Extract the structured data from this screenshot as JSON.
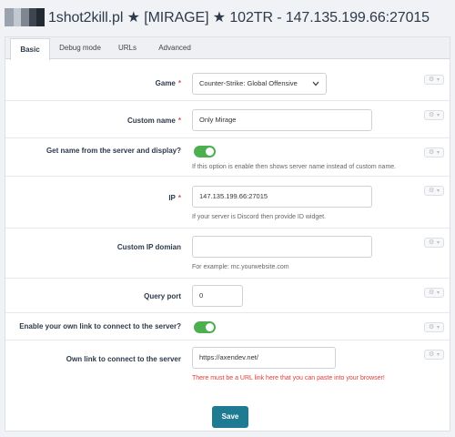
{
  "header": {
    "title": "1shot2kill.pl ★ [MIRAGE] ★ 102TR - 147.135.199.66:27015"
  },
  "tabs": [
    {
      "label": "Basic",
      "active": true
    },
    {
      "label": "Debug mode",
      "active": false
    },
    {
      "label": "URLs",
      "active": false
    },
    {
      "label": "Advanced",
      "active": false
    }
  ],
  "form": {
    "game": {
      "label": "Game",
      "required_mark": "*",
      "value": "Counter-Strike: Global Offensive"
    },
    "custom_name": {
      "label": "Custom name",
      "required_mark": "*",
      "value": "Only Mirage"
    },
    "get_name": {
      "label": "Get name from the server and display?",
      "enabled": true,
      "help": "If this option is enable then shows server name instead of custom name."
    },
    "ip": {
      "label": "IP",
      "required_mark": "*",
      "value": "147.135.199.66:27015",
      "help": "If your server is Discord then provide ID widget."
    },
    "custom_ip_domain": {
      "label": "Custom IP domian",
      "value": "",
      "help": "For example: mc.yourwebsite.com"
    },
    "query_port": {
      "label": "Query port",
      "value": "0"
    },
    "own_link_enable": {
      "label": "Enable your own link to connect to the server?",
      "enabled": true
    },
    "own_link": {
      "label": "Own link to connect to the server",
      "value": "https://axendev.net/",
      "help": "There must be a URL link here that you can paste into your browser!"
    }
  },
  "row_action_icon": "gear-icon",
  "save_label": "Save",
  "colors": {
    "accent": "#1f7b92",
    "toggle_on": "#4caf50",
    "required": "#d9534f",
    "error": "#e53935"
  }
}
